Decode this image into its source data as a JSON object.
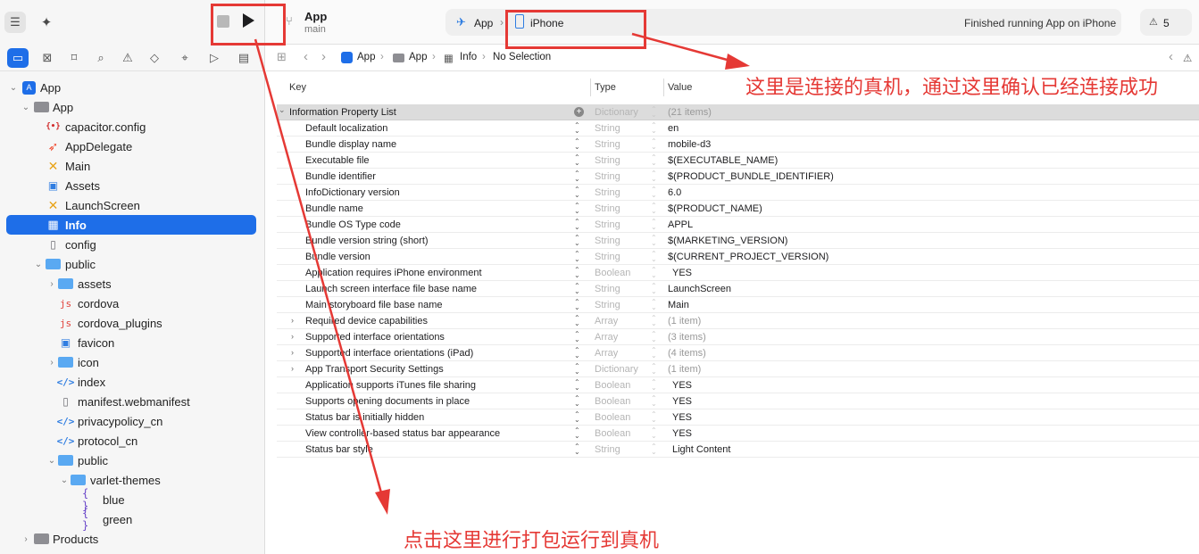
{
  "toolbar": {
    "project_name": "App",
    "branch": "main",
    "scheme": "App",
    "device": "iPhone",
    "status": "Finished running App on iPhone",
    "warning_count": "5"
  },
  "jumpbar": {
    "crumbs": [
      "App",
      "App",
      "Info",
      "No Selection"
    ]
  },
  "navigator": {
    "items": [
      {
        "label": "App"
      },
      {
        "label": "App"
      },
      {
        "label": "capacitor.config"
      },
      {
        "label": "AppDelegate"
      },
      {
        "label": "Main"
      },
      {
        "label": "Assets"
      },
      {
        "label": "LaunchScreen"
      },
      {
        "label": "Info"
      },
      {
        "label": "config"
      },
      {
        "label": "public"
      },
      {
        "label": "assets"
      },
      {
        "label": "cordova"
      },
      {
        "label": "cordova_plugins"
      },
      {
        "label": "favicon"
      },
      {
        "label": "icon"
      },
      {
        "label": "index"
      },
      {
        "label": "manifest.webmanifest"
      },
      {
        "label": "privacypolicy_cn"
      },
      {
        "label": "protocol_cn"
      },
      {
        "label": "public"
      },
      {
        "label": "varlet-themes"
      },
      {
        "label": "blue"
      },
      {
        "label": "green"
      },
      {
        "label": "Products"
      }
    ]
  },
  "plist": {
    "headers": {
      "key": "Key",
      "type": "Type",
      "value": "Value"
    },
    "root": {
      "key": "Information Property List",
      "type": "Dictionary",
      "value": "(21 items)"
    },
    "rows": [
      {
        "key": "Default localization",
        "type": "String",
        "value": "en"
      },
      {
        "key": "Bundle display name",
        "type": "String",
        "value": "mobile-d3"
      },
      {
        "key": "Executable file",
        "type": "String",
        "value": "$(EXECUTABLE_NAME)"
      },
      {
        "key": "Bundle identifier",
        "type": "String",
        "value": "$(PRODUCT_BUNDLE_IDENTIFIER)"
      },
      {
        "key": "InfoDictionary version",
        "type": "String",
        "value": "6.0"
      },
      {
        "key": "Bundle name",
        "type": "String",
        "value": "$(PRODUCT_NAME)"
      },
      {
        "key": "Bundle OS Type code",
        "type": "String",
        "value": "APPL"
      },
      {
        "key": "Bundle version string (short)",
        "type": "String",
        "value": "$(MARKETING_VERSION)"
      },
      {
        "key": "Bundle version",
        "type": "String",
        "value": "$(CURRENT_PROJECT_VERSION)"
      },
      {
        "key": "Application requires iPhone environment",
        "type": "Boolean",
        "value": "YES"
      },
      {
        "key": "Launch screen interface file base name",
        "type": "String",
        "value": "LaunchScreen"
      },
      {
        "key": "Main storyboard file base name",
        "type": "String",
        "value": "Main"
      },
      {
        "key": "Required device capabilities",
        "type": "Array",
        "value": "(1 item)"
      },
      {
        "key": "Supported interface orientations",
        "type": "Array",
        "value": "(3 items)"
      },
      {
        "key": "Supported interface orientations (iPad)",
        "type": "Array",
        "value": "(4 items)"
      },
      {
        "key": "App Transport Security Settings",
        "type": "Dictionary",
        "value": "(1 item)"
      },
      {
        "key": "Application supports iTunes file sharing",
        "type": "Boolean",
        "value": "YES"
      },
      {
        "key": "Supports opening documents in place",
        "type": "Boolean",
        "value": "YES"
      },
      {
        "key": "Status bar is initially hidden",
        "type": "Boolean",
        "value": "YES"
      },
      {
        "key": "View controller-based status bar appearance",
        "type": "Boolean",
        "value": "YES"
      },
      {
        "key": "Status bar style",
        "type": "String",
        "value": "Light Content"
      }
    ]
  },
  "annotations": {
    "device_note": "这里是连接的真机，通过这里确认已经连接成功",
    "run_note": "点击这里进行打包运行到真机"
  },
  "colors": {
    "accent": "#1e6ee8",
    "annotation": "#e53935"
  }
}
